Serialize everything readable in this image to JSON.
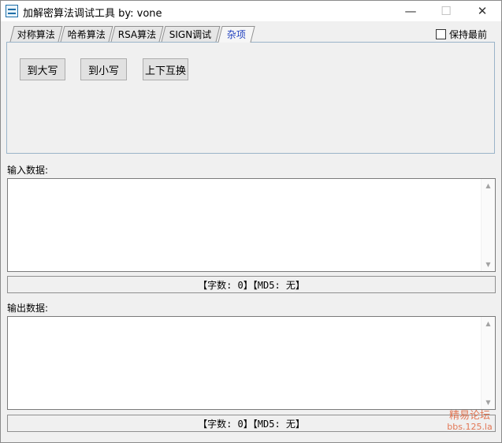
{
  "window": {
    "title": "加解密算法调试工具  by: vone",
    "controls": {
      "minimize": "—",
      "maximize": "☐",
      "close": "✕"
    }
  },
  "tabs": [
    {
      "label": "对称算法"
    },
    {
      "label": "哈希算法"
    },
    {
      "label": "RSA算法"
    },
    {
      "label": "SIGN调试"
    },
    {
      "label": "杂项",
      "active": true
    }
  ],
  "keep_on_top": {
    "label": "保持最前",
    "checked": false
  },
  "misc_panel": {
    "buttons": {
      "upper": "到大写",
      "lower": "到小写",
      "swap": "上下互换"
    }
  },
  "input": {
    "label": "输入数据:",
    "value": "",
    "status": "【字数: 0】【MD5: 无】"
  },
  "output": {
    "label": "输出数据:",
    "value": "",
    "status": "【字数: 0】【MD5: 无】"
  },
  "watermark": {
    "line1": "精易论坛",
    "line2": "bbs.125.la"
  },
  "colors": {
    "active_tab_text": "#1f3fbf",
    "panel_border": "#9ab4c9",
    "watermark": "#e0623a"
  }
}
